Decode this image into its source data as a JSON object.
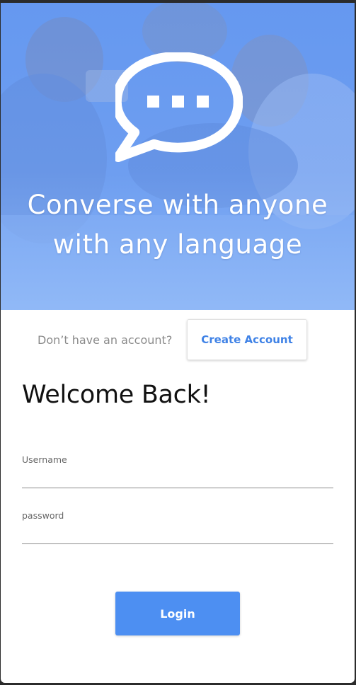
{
  "hero": {
    "title_line1": "Converse with anyone",
    "title_line2": "with any language",
    "icon": "speech-bubble-icon"
  },
  "signup": {
    "prompt": "Don’t have an account?",
    "create_label": "Create Account"
  },
  "login": {
    "heading": "Welcome Back!",
    "username_label": "Username",
    "password_label": "password",
    "username_value": "",
    "password_value": "",
    "submit_label": "Login"
  },
  "colors": {
    "accent": "#4d8ff2",
    "link": "#3f82e6",
    "hero_tint": "#6f9ff0"
  }
}
